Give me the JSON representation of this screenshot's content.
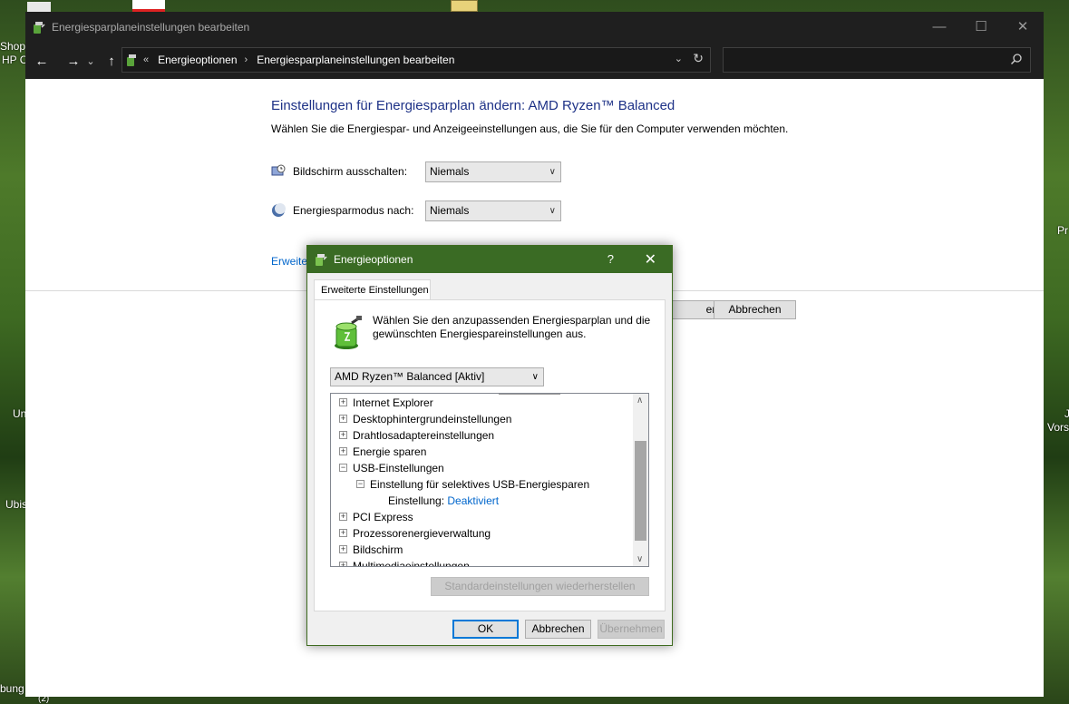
{
  "desktop": {
    "labels": [
      "Shop",
      "HP C",
      "Pr",
      "Un",
      "J",
      "Vorst",
      "Ubis",
      "bung",
      "(2)"
    ]
  },
  "window": {
    "title": "Energiesparplaneinstellungen bearbeiten",
    "controls": {
      "minimize": "—",
      "maximize": "☐",
      "close": "✕"
    },
    "address": {
      "back": "←",
      "forward": "→",
      "recent": "⌄",
      "up": "↑",
      "overflow": "«",
      "crumbs": [
        "Energieoptionen",
        "Energiesparplaneinstellungen bearbeiten"
      ],
      "separator": "›"
    },
    "search_placeholder": ""
  },
  "page": {
    "heading": "Einstellungen für Energiesparplan ändern: AMD Ryzen™ Balanced",
    "subtitle": "Wählen Sie die Energiespar- und Anzeigeeinstellungen aus, die Sie für den Computer verwenden möchten.",
    "display_off": {
      "label": "Bildschirm ausschalten:",
      "value": "Niemals",
      "icon": "monitor-clock-icon"
    },
    "sleep": {
      "label": "Energiesparmodus nach:",
      "value": "Niemals",
      "icon": "moon-icon"
    },
    "advanced_link": "Erweite",
    "save_partial": "ern",
    "cancel": "Abbrechen"
  },
  "dialog": {
    "title": "Energieoptionen",
    "help": "?",
    "close": "✕",
    "tab": "Erweiterte Einstellungen",
    "description": "Wählen Sie den anzupassenden Energiesparplan und die gewünschten Energiespareinstellungen aus.",
    "plan": "AMD Ryzen™ Balanced [Aktiv]",
    "tree": [
      {
        "text": "Internet Explorer",
        "exp": "+"
      },
      {
        "text": "Desktophintergrundeinstellungen",
        "exp": "+"
      },
      {
        "text": "Drahtlosadaptereinstellungen",
        "exp": "+"
      },
      {
        "text": "Energie sparen",
        "exp": "+"
      },
      {
        "text": "USB-Einstellungen",
        "exp": "−"
      },
      {
        "text": "Einstellung für selektives USB-Energiesparen",
        "exp": "−"
      },
      {
        "label": "Einstellung:",
        "value": "Deaktiviert"
      },
      {
        "text": "PCI Express",
        "exp": "+"
      },
      {
        "text": "Prozessorenergieverwaltung",
        "exp": "+"
      },
      {
        "text": "Bildschirm",
        "exp": "+"
      },
      {
        "text": "Multimediaeinstellungen",
        "exp": "+"
      }
    ],
    "restore": "Standardeinstellungen wiederherstellen",
    "ok": "OK",
    "cancel": "Abbrechen",
    "apply": "Übernehmen"
  },
  "colors": {
    "accent_title": "#1e3287",
    "dialog_titlebar": "#3a6b24",
    "link": "#0066cc"
  }
}
